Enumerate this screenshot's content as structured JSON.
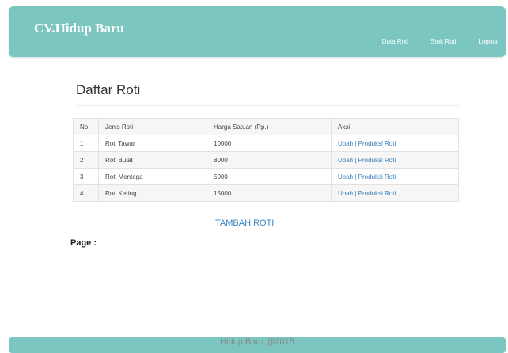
{
  "header": {
    "brand": "CV.Hidup Baru",
    "nav": [
      "Data Roti",
      "Stok Roti",
      "Logout"
    ]
  },
  "main": {
    "title": "Daftar Roti",
    "columns": [
      "No.",
      "Jenis Roti",
      "Harga Satuan (Rp.)",
      "Aksi"
    ],
    "rows": [
      {
        "no": "1",
        "jenis": "Roti Tawar",
        "harga": "10000"
      },
      {
        "no": "2",
        "jenis": "Roti Bulat",
        "harga": "8000"
      },
      {
        "no": "3",
        "jenis": "Roti Mentega",
        "harga": "5000"
      },
      {
        "no": "4",
        "jenis": "Roti Kering",
        "harga": "15000"
      }
    ],
    "actions": {
      "edit": "Ubah",
      "separator": "|",
      "produce": "Produksi Roti"
    },
    "add_button": "TAMBAH ROTI",
    "page_label": "Page :"
  },
  "footer": {
    "text": "Hidup Baru @2015"
  }
}
